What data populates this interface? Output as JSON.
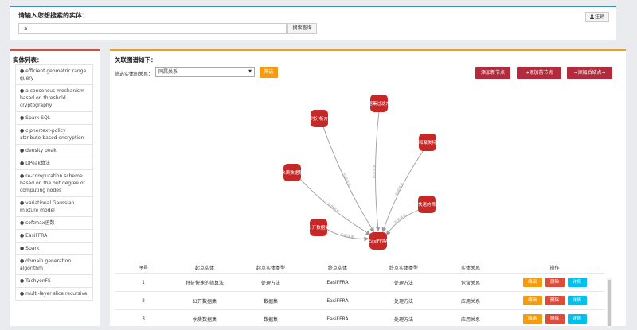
{
  "search": {
    "title": "请输入您想搜索的实体：",
    "value": "a",
    "button_label": "搜索查询",
    "logout_label": "注销",
    "logout_icon": "user-icon"
  },
  "entity_list": {
    "title": "实体列表：",
    "items": [
      "● efficient geometric range query",
      "● a consensus mechanism based on threshold cryptography",
      "● Spark SQL",
      "● ciphertext-policy attribute-based encryption",
      "● density peak",
      "● DPeak算法",
      "● re-computation scheme based on the out degree of computing nodes",
      "● variational Gaussian mixture model",
      "● softmax函数",
      "● EasiFFRA",
      "● Spark",
      "● domain generation algorithm",
      "● TachyonFS",
      "● multi-layer slice recursive"
    ]
  },
  "graph_panel": {
    "title": "关联图谱如下：",
    "filter_label": "筛选实体间关系：",
    "filter_selected": "同属关系",
    "filter_button": "筛选",
    "add_node_label": "添加新节点",
    "add_prev_label": "➜添加前节点",
    "add_next_label": "➜添加后结点➜",
    "accent_color": "#f39c12",
    "node_color": "#c62828",
    "center_node": "EasiFFRA",
    "nodes": [
      {
        "label": "同时分析方法",
        "edge": "应用关系"
      },
      {
        "label": "数据集过滤方法",
        "edge": "包含关系"
      },
      {
        "label": "非聚类和聚类特征聚合",
        "edge": "应用关系"
      },
      {
        "label": "水质数据集",
        "edge": "应用关系"
      },
      {
        "label": "特征快速的筛算法",
        "edge": "包含关系"
      },
      {
        "label": "公开数据集",
        "edge": "应用关系"
      }
    ]
  },
  "table": {
    "headers": [
      "序号",
      "起点实体",
      "起点实体类型",
      "终点实体",
      "终点实体类型",
      "实体关系",
      "操作"
    ],
    "rows": [
      {
        "index": "1",
        "start": "特征快速的筛算法",
        "start_type": "处理方法",
        "end": "EasiFFRA",
        "end_type": "处理方法",
        "relation": "包含关系"
      },
      {
        "index": "2",
        "start": "公开数据集",
        "start_type": "数据集",
        "end": "EasiFFRA",
        "end_type": "处理方法",
        "relation": "应用关系"
      },
      {
        "index": "3",
        "start": "水质数据集",
        "start_type": "数据集",
        "end": "EasiFFRA",
        "end_type": "处理方法",
        "relation": "应用关系"
      }
    ],
    "op_edit": "编辑",
    "op_delete": "删除",
    "op_detail": "详情"
  }
}
